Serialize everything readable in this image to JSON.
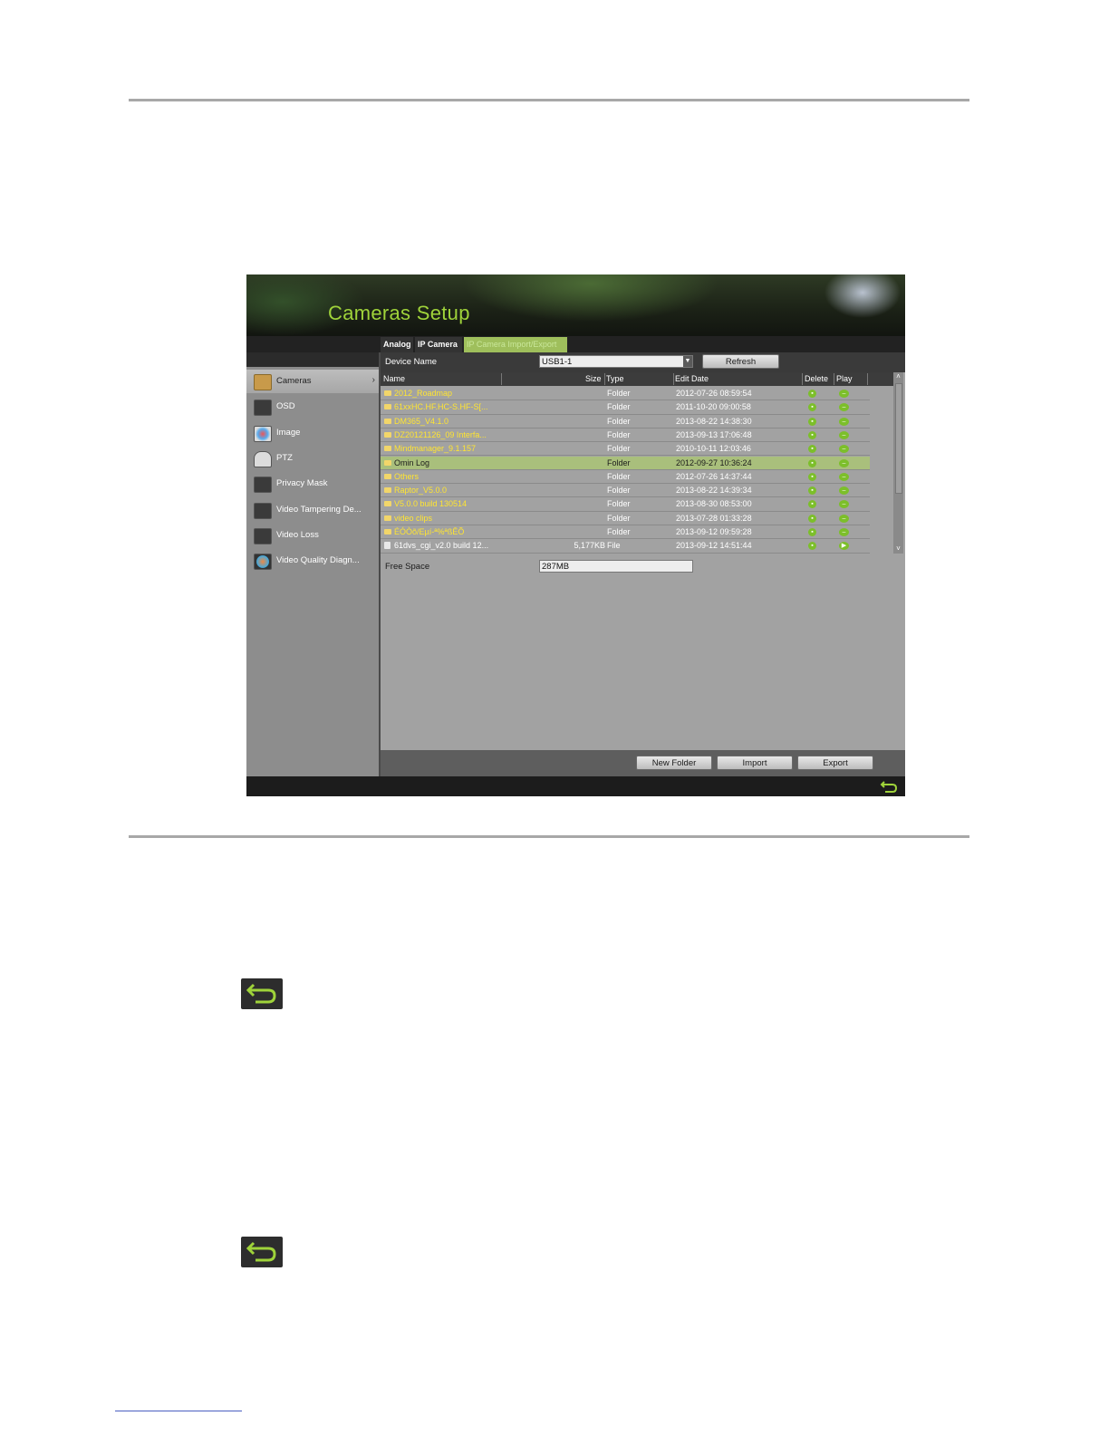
{
  "window": {
    "title": "Cameras Setup",
    "tabs": [
      {
        "label": "Analog"
      },
      {
        "label": "IP Camera"
      },
      {
        "label": "IP Camera Import/Export"
      }
    ]
  },
  "sidebar": {
    "items": [
      {
        "label": "Cameras",
        "icon": "lock-icon",
        "active": true
      },
      {
        "label": "OSD",
        "icon": "osd-icon"
      },
      {
        "label": "Image",
        "icon": "image-icon"
      },
      {
        "label": "PTZ",
        "icon": "ptz-icon"
      },
      {
        "label": "Privacy Mask",
        "icon": "privacy-mask-icon"
      },
      {
        "label": "Video Tampering De...",
        "icon": "video-tampering-icon"
      },
      {
        "label": "Video Loss",
        "icon": "video-loss-icon"
      },
      {
        "label": "Video Quality Diagn...",
        "icon": "video-quality-icon"
      }
    ]
  },
  "device": {
    "label": "Device Name",
    "value": "USB1-1",
    "refresh_label": "Refresh"
  },
  "table": {
    "headers": {
      "name": "Name",
      "size": "Size",
      "type": "Type",
      "date": "Edit Date",
      "delete": "Delete",
      "play": "Play"
    },
    "rows": [
      {
        "name": "2012_Roadmap",
        "size": "",
        "type": "Folder",
        "date": "2012-07-26 08:59:54"
      },
      {
        "name": "61xxHC.HF.HC-S.HF-S[...",
        "size": "",
        "type": "Folder",
        "date": "2011-10-20 09:00:58"
      },
      {
        "name": "DM365_V4.1.0",
        "size": "",
        "type": "Folder",
        "date": "2013-08-22 14:38:30"
      },
      {
        "name": "DZ20121126_09 Interfa...",
        "size": "",
        "type": "Folder",
        "date": "2013-09-13 17:06:48"
      },
      {
        "name": "Mindmanager_9.1.157",
        "size": "",
        "type": "Folder",
        "date": "2010-10-11 12:03:46"
      },
      {
        "name": "Omin Log",
        "size": "",
        "type": "Folder",
        "date": "2012-09-27 10:36:24"
      },
      {
        "name": "Others",
        "size": "",
        "type": "Folder",
        "date": "2012-07-26 14:37:44"
      },
      {
        "name": "Raptor_V5.0.0",
        "size": "",
        "type": "Folder",
        "date": "2013-08-22 14:39:34"
      },
      {
        "name": "V5.0.0 build 130514",
        "size": "",
        "type": "Folder",
        "date": "2013-08-30 08:53:00"
      },
      {
        "name": "video clips",
        "size": "",
        "type": "Folder",
        "date": "2013-07-28 01:33:28"
      },
      {
        "name": "ÉÓÒõ/Eµí-ª%ªßÊÕ",
        "size": "",
        "type": "Folder",
        "date": "2013-09-12 09:59:28"
      },
      {
        "name": "61dvs_cgi_v2.0 build 12...",
        "size": "5,177KB",
        "type": "File",
        "date": "2013-09-12 14:51:44"
      }
    ]
  },
  "free_space": {
    "label": "Free Space",
    "value": "287MB"
  },
  "actions": {
    "new_folder": "New Folder",
    "import": "Import",
    "export": "Export"
  }
}
